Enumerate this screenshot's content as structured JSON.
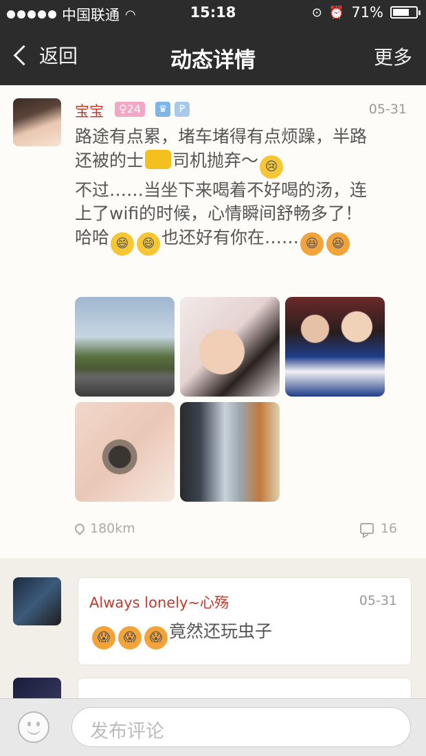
{
  "status": {
    "carrier": "中国联通",
    "time": "15:18",
    "battery": "71%",
    "battery_level": 0.71
  },
  "nav": {
    "back": "返回",
    "title": "动态详情",
    "more": "更多"
  },
  "post": {
    "name": "宝宝",
    "age_badge": "♀24",
    "date": "05-31",
    "content_1": "路途有点累，堵车堵得有点烦躁，半路还被的士",
    "content_2": "司机抛弃～",
    "content_3": "不过……当坐下来喝着不好喝的汤，连上了wifi的时候，心情瞬间舒畅多了！哈哈",
    "content_4": "也还好有你在……",
    "distance": "180km",
    "comment_count": "16"
  },
  "comments": [
    {
      "name": "Always lonely~心殇",
      "date": "05-31",
      "text": "竟然还玩虫子"
    },
    {
      "name": "",
      "date": "",
      "text": ""
    }
  ],
  "bottom": {
    "placeholder": "发布评论"
  },
  "colors": {
    "bar_bg": "#2c2c2c",
    "name_red": "#c0392b",
    "page_bg": "#f1efe8"
  }
}
